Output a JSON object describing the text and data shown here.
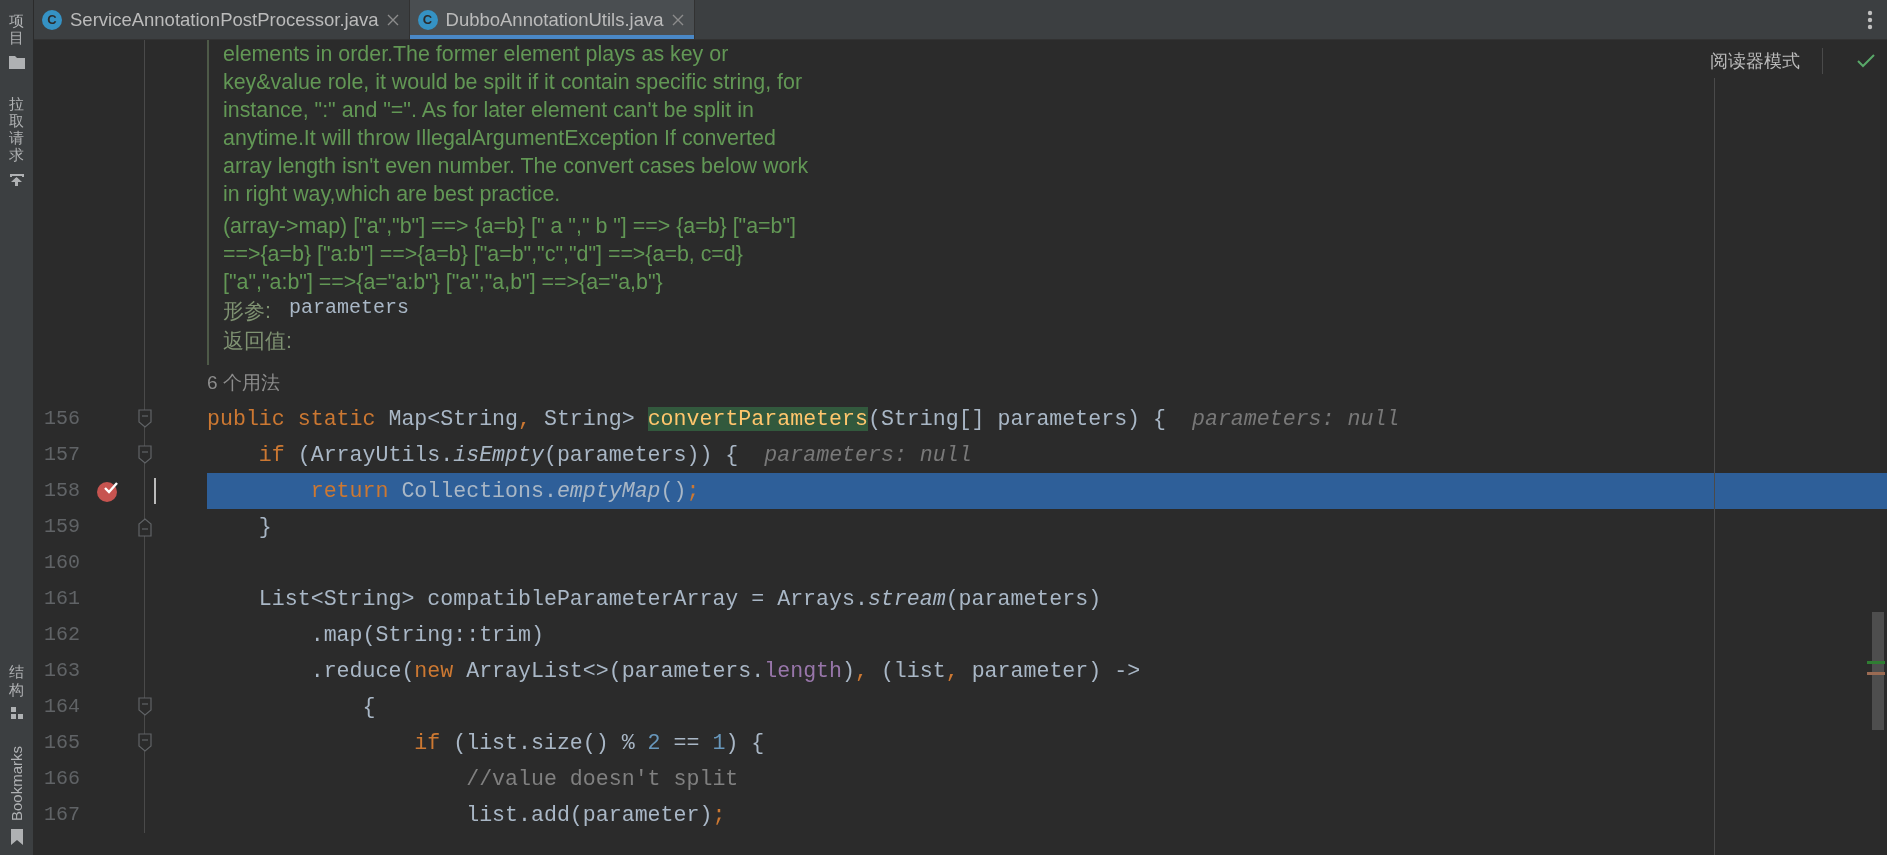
{
  "tool_strip": {
    "top": [
      {
        "label": "项目",
        "kind": "project",
        "rotated": false
      },
      {
        "label": "拉取请求",
        "kind": "pull-requests",
        "rotated": false
      }
    ],
    "bottom": [
      {
        "label": "结构",
        "kind": "structure",
        "rotated": false
      },
      {
        "label": "Bookmarks",
        "kind": "bookmarks",
        "rotated": true
      }
    ]
  },
  "tabs": [
    {
      "icon_letter": "C",
      "label": "ServiceAnnotationPostProcessor.java",
      "selected": false
    },
    {
      "icon_letter": "C",
      "label": "DubboAnnotationUtils.java",
      "selected": true
    }
  ],
  "reader_mode": {
    "label": "阅读器模式"
  },
  "doc": {
    "paragraphs": [
      "elements in order.The former element plays as key or key&value role, it would be spilt if it contain specific string, for instance, \":\" and \"=\". As for later element can't be split in anytime.It will throw IllegalArgumentException If converted array length isn't even number. The convert cases below work in right way,which are best practice.",
      "(array->map) [\"a\",\"b\"] ==> {a=b} [\" a \",\" b \"] ==> {a=b} [\"a=b\"] ==>{a=b} [\"a:b\"] ==>{a=b} [\"a=b\",\"c\",\"d\"] ==>{a=b, c=d} [\"a\",\"a:b\"] ==>{a=\"a:b\"} [\"a\",\"a,b\"] ==>{a=\"a,b\"}"
    ],
    "params_label": "形参:",
    "params_value": "parameters",
    "returns_label": "返回值:"
  },
  "usages": "6 个用法",
  "lines": [
    {
      "number": "156",
      "fold_start": true,
      "fold_end": false,
      "breakpoint": false,
      "current": false,
      "tokens": [
        {
          "text": "public static ",
          "kind": "keyword"
        },
        {
          "text": "Map<String",
          "kind": "plain"
        },
        {
          "text": ",",
          "kind": "keyword"
        },
        {
          "text": " String> ",
          "kind": "plain"
        },
        {
          "text": "convertParameters",
          "kind": "declaration"
        },
        {
          "text": "(String[] parameters) {",
          "kind": "plain"
        }
      ],
      "hint": "parameters: null"
    },
    {
      "number": "157",
      "fold_start": true,
      "fold_end": false,
      "breakpoint": false,
      "current": false,
      "tokens": [
        {
          "text": "    if",
          "kind": "keyword"
        },
        {
          "text": " (ArrayUtils.",
          "kind": "plain"
        },
        {
          "text": "isEmpty",
          "kind": "italic"
        },
        {
          "text": "(parameters)) {",
          "kind": "plain"
        }
      ],
      "hint": "parameters: null"
    },
    {
      "number": "158",
      "fold_start": false,
      "fold_end": false,
      "breakpoint": true,
      "current": true,
      "tokens": [
        {
          "text": "        return",
          "kind": "keyword"
        },
        {
          "text": " Collections.",
          "kind": "plain"
        },
        {
          "text": "emptyMap",
          "kind": "italic"
        },
        {
          "text": "()",
          "kind": "plain"
        },
        {
          "text": ";",
          "kind": "keyword"
        }
      ]
    },
    {
      "number": "159",
      "fold_start": false,
      "fold_end": true,
      "breakpoint": false,
      "current": false,
      "tokens": [
        {
          "text": "    }",
          "kind": "plain"
        }
      ]
    },
    {
      "number": "160",
      "fold_start": false,
      "fold_end": false,
      "breakpoint": false,
      "current": false
    },
    {
      "number": "161",
      "fold_start": false,
      "fold_end": false,
      "breakpoint": false,
      "current": false,
      "tokens": [
        {
          "text": "    List<String> compatibleParameterArray = Arrays.",
          "kind": "plain"
        },
        {
          "text": "stream",
          "kind": "italic"
        },
        {
          "text": "(parameters)",
          "kind": "plain"
        }
      ]
    },
    {
      "number": "162",
      "fold_start": false,
      "fold_end": false,
      "breakpoint": false,
      "current": false,
      "tokens": [
        {
          "text": "        .map(String::trim)",
          "kind": "plain"
        }
      ]
    },
    {
      "number": "163",
      "fold_start": false,
      "fold_end": false,
      "breakpoint": false,
      "current": false,
      "tokens": [
        {
          "text": "        .reduce(",
          "kind": "plain"
        },
        {
          "text": "new",
          "kind": "keyword"
        },
        {
          "text": " ArrayList<>(parameters.",
          "kind": "plain"
        },
        {
          "text": "length",
          "kind": "field"
        },
        {
          "text": ")",
          "kind": "plain"
        },
        {
          "text": ",",
          "kind": "keyword"
        },
        {
          "text": " (list",
          "kind": "plain"
        },
        {
          "text": ",",
          "kind": "keyword"
        },
        {
          "text": " parameter) ->",
          "kind": "plain"
        }
      ]
    },
    {
      "number": "164",
      "fold_start": true,
      "fold_end": false,
      "breakpoint": false,
      "current": false,
      "tokens": [
        {
          "text": "            {",
          "kind": "plain"
        }
      ]
    },
    {
      "number": "165",
      "fold_start": true,
      "fold_end": false,
      "breakpoint": false,
      "current": false,
      "tokens": [
        {
          "text": "                if",
          "kind": "keyword"
        },
        {
          "text": " (list.size() % ",
          "kind": "plain"
        },
        {
          "text": "2",
          "kind": "number"
        },
        {
          "text": " == ",
          "kind": "plain"
        },
        {
          "text": "1",
          "kind": "number"
        },
        {
          "text": ") {",
          "kind": "plain"
        }
      ]
    },
    {
      "number": "166",
      "fold_start": false,
      "fold_end": false,
      "breakpoint": false,
      "current": false,
      "tokens": [
        {
          "text": "                    //value doesn't split",
          "kind": "comment"
        }
      ]
    },
    {
      "number": "167",
      "fold_start": false,
      "fold_end": false,
      "breakpoint": false,
      "current": false,
      "tokens": [
        {
          "text": "                    list.add(parameter)",
          "kind": "plain"
        },
        {
          "text": ";",
          "kind": "keyword"
        }
      ]
    }
  ]
}
